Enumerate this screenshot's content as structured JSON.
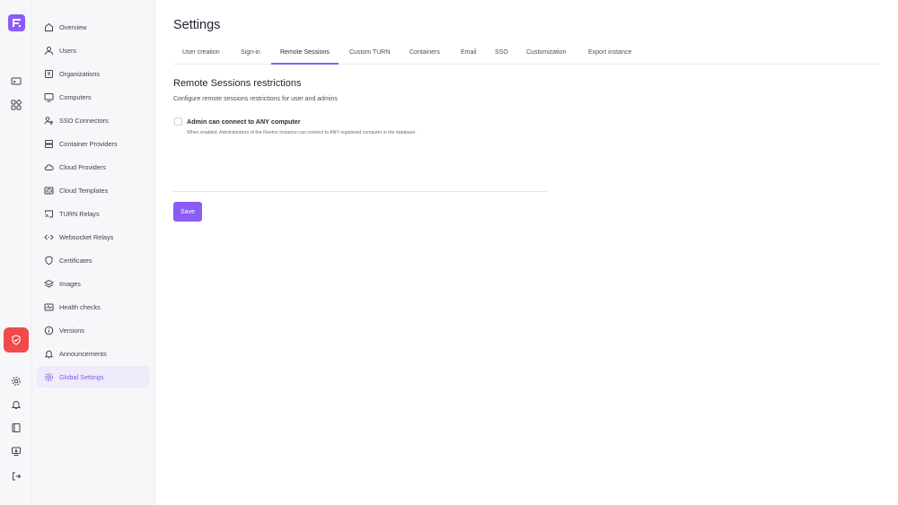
{
  "rail": {
    "icons": [
      "logo-icon",
      "monitor-icon",
      "apps-icon",
      "shield-check-icon",
      "gear-icon",
      "bell-icon",
      "book-icon",
      "download-icon",
      "logout-icon"
    ]
  },
  "sidebar": {
    "items": [
      {
        "label": "Overview",
        "icon": "home-icon"
      },
      {
        "label": "Users",
        "icon": "user-icon"
      },
      {
        "label": "Organizations",
        "icon": "building-icon"
      },
      {
        "label": "Computers",
        "icon": "monitor-icon"
      },
      {
        "label": "SSO Connectors",
        "icon": "users-key-icon"
      },
      {
        "label": "Container Providers",
        "icon": "server-icon"
      },
      {
        "label": "Cloud Providers",
        "icon": "cloud-icon"
      },
      {
        "label": "Cloud Templates",
        "icon": "cloud-template-icon"
      },
      {
        "label": "TURN Relays",
        "icon": "cast-icon"
      },
      {
        "label": "Websocket Relays",
        "icon": "code-icon"
      },
      {
        "label": "Certificates",
        "icon": "shield-icon"
      },
      {
        "label": "Images",
        "icon": "layers-icon"
      },
      {
        "label": "Health checks",
        "icon": "activity-icon"
      },
      {
        "label": "Versions",
        "icon": "info-icon"
      },
      {
        "label": "Announcements",
        "icon": "bell-icon"
      },
      {
        "label": "Global Settings",
        "icon": "gear-icon",
        "active": true
      }
    ]
  },
  "main": {
    "title": "Settings",
    "tabs": [
      {
        "label": "User creation"
      },
      {
        "label": "Sign-in"
      },
      {
        "label": "Remote Sessions",
        "active": true
      },
      {
        "label": "Custom TURN"
      },
      {
        "label": "Containers"
      },
      {
        "label": "Email"
      },
      {
        "label": "SSO"
      },
      {
        "label": "Customization"
      },
      {
        "label": "Export instance"
      }
    ],
    "section": {
      "title": "Remote Sessions restrictions",
      "subtitle": "Configure remote sessions restrictions for user and admins",
      "checkbox_label": "Admin can connect to ANY computer",
      "checkbox_help": "When enabled, Administrators of the Reemo Instance can connect to ANY registered computer in the database.",
      "checkbox_checked": false
    },
    "save_label": "Save"
  },
  "colors": {
    "accent": "#8b5cf6",
    "active_bg": "#efebfc",
    "danger": "#f04a4a"
  }
}
